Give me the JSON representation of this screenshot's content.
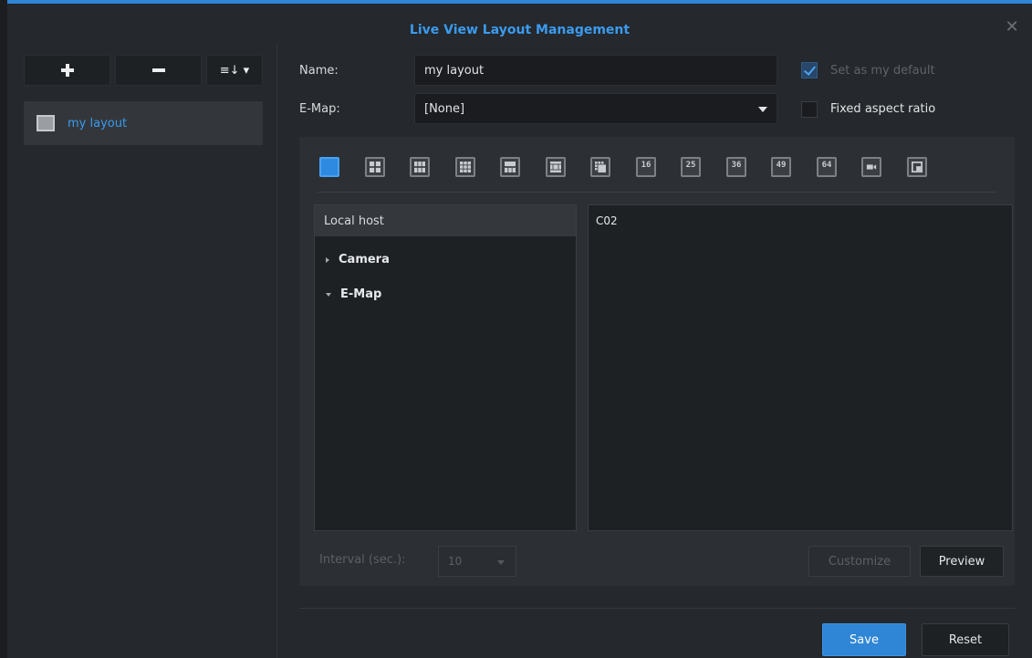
{
  "window": {
    "title": "Live View Layout Management",
    "close_icon": "close-icon",
    "accent_color": "#2f86d6"
  },
  "sidebar": {
    "buttons": [
      {
        "name": "add",
        "icon": "plus-icon"
      },
      {
        "name": "remove",
        "icon": "minus-icon"
      },
      {
        "name": "sort",
        "icon": "sort-menu-icon",
        "label": "≡↓ ▾"
      }
    ],
    "layouts": [
      {
        "label": "my layout",
        "selected": true
      }
    ]
  },
  "form": {
    "name_label": "Name:",
    "name_value": "my layout",
    "emap_label": "E-Map:",
    "emap_value": "[None]",
    "default_label": "Set as my default",
    "default_checked": true,
    "default_disabled": true,
    "aspect_label": "Fixed aspect ratio",
    "aspect_checked": false
  },
  "layout_toolbar": {
    "icons": [
      {
        "name": "layout-1",
        "label": "",
        "active": true
      },
      {
        "name": "layout-4",
        "label": ""
      },
      {
        "name": "layout-6",
        "label": ""
      },
      {
        "name": "layout-8",
        "label": ""
      },
      {
        "name": "layout-9",
        "label": ""
      },
      {
        "name": "layout-10",
        "label": ""
      },
      {
        "name": "layout-13",
        "label": ""
      },
      {
        "name": "layout-16",
        "label": "16"
      },
      {
        "name": "layout-25",
        "label": "25"
      },
      {
        "name": "layout-36",
        "label": "36"
      },
      {
        "name": "layout-49",
        "label": "49"
      },
      {
        "name": "layout-64",
        "label": "64"
      },
      {
        "name": "camera-layout",
        "label": ""
      },
      {
        "name": "custom-layout",
        "label": ""
      }
    ]
  },
  "tree": {
    "header": "Local host",
    "nodes": [
      {
        "label": "Camera",
        "expanded": false
      },
      {
        "label": "E-Map",
        "expanded": true
      }
    ]
  },
  "preview": {
    "cell_label": "C02"
  },
  "footer": {
    "interval_label": "Interval (sec.):",
    "interval_value": "10",
    "customize_label": "Customize",
    "preview_label": "Preview",
    "save_label": "Save",
    "reset_label": "Reset"
  }
}
